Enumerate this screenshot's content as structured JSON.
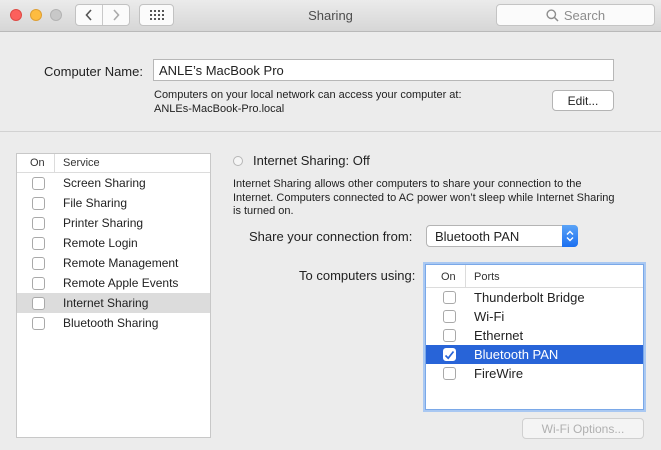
{
  "window": {
    "title": "Sharing"
  },
  "search": {
    "placeholder": "Search"
  },
  "computer_name": {
    "label": "Computer Name:",
    "value": "ANLE’s MacBook Pro",
    "note_line1": "Computers on your local network can access your computer at:",
    "note_line2": "ANLEs-MacBook-Pro.local",
    "edit_label": "Edit..."
  },
  "services": {
    "header_on": "On",
    "header_service": "Service",
    "items": [
      {
        "label": "Screen Sharing",
        "on": false
      },
      {
        "label": "File Sharing",
        "on": false
      },
      {
        "label": "Printer Sharing",
        "on": false
      },
      {
        "label": "Remote Login",
        "on": false
      },
      {
        "label": "Remote Management",
        "on": false
      },
      {
        "label": "Remote Apple Events",
        "on": false
      },
      {
        "label": "Internet Sharing",
        "on": false,
        "selected": true
      },
      {
        "label": "Bluetooth Sharing",
        "on": false
      }
    ]
  },
  "internet_sharing": {
    "status": "Internet Sharing: Off",
    "description": "Internet Sharing allows other computers to share your connection to the Internet. Computers connected to AC power won’t sleep while Internet Sharing is turned on.",
    "share_from_label": "Share your connection from:",
    "share_from_value": "Bluetooth PAN",
    "to_computers_label": "To computers using:",
    "ports_header_on": "On",
    "ports_header_ports": "Ports",
    "ports": [
      {
        "label": "Thunderbolt Bridge",
        "on": false
      },
      {
        "label": "Wi-Fi",
        "on": false
      },
      {
        "label": "Ethernet",
        "on": false
      },
      {
        "label": "Bluetooth PAN",
        "on": true,
        "selected": true
      },
      {
        "label": "FireWire",
        "on": false
      }
    ],
    "wifi_options_label": "Wi-Fi Options..."
  },
  "colors": {
    "selection": "#2864d8",
    "accent": "#1b6ff0"
  }
}
